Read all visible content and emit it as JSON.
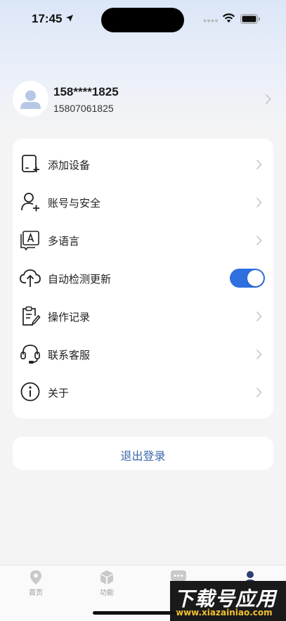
{
  "status_bar": {
    "time": "17:45"
  },
  "profile": {
    "masked_phone": "158****1825",
    "phone": "15807061825"
  },
  "menu": {
    "items": [
      {
        "label": "添加设备",
        "icon": "add-device-icon",
        "type": "link"
      },
      {
        "label": "账号与安全",
        "icon": "user-plus-icon",
        "type": "link"
      },
      {
        "label": "多语言",
        "icon": "language-icon",
        "type": "link"
      },
      {
        "label": "自动检测更新",
        "icon": "cloud-upload-icon",
        "type": "toggle",
        "enabled": true
      },
      {
        "label": "操作记录",
        "icon": "clipboard-edit-icon",
        "type": "link"
      },
      {
        "label": "联系客服",
        "icon": "headset-icon",
        "type": "link"
      },
      {
        "label": "关于",
        "icon": "info-icon",
        "type": "link"
      }
    ]
  },
  "logout": {
    "label": "退出登录"
  },
  "tabs": [
    {
      "label": "首页",
      "icon": "location-pin-icon",
      "active": false
    },
    {
      "label": "功能",
      "icon": "cube-icon",
      "active": false
    },
    {
      "label": "",
      "icon": "chat-icon",
      "active": false
    },
    {
      "label": "",
      "icon": "person-icon",
      "active": true
    }
  ],
  "watermark": {
    "title": "下载号应用",
    "url": "www.xiazainiao.com"
  },
  "colors": {
    "accent": "#2f6fe0",
    "logout_text": "#3a68a8",
    "active_tab": "#2b3f70"
  }
}
